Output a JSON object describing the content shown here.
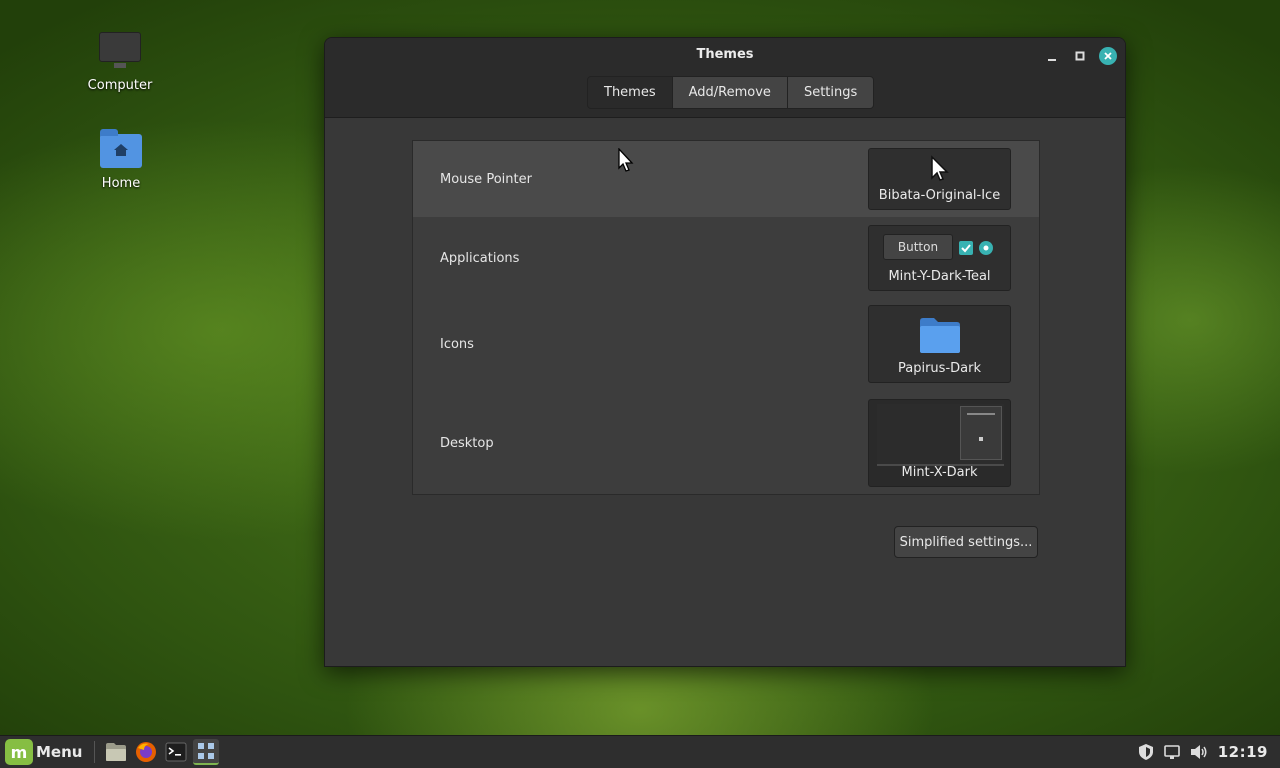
{
  "desktop": {
    "icons": [
      {
        "label": "Computer",
        "icon": "computer-icon"
      },
      {
        "label": "Home",
        "icon": "home-folder-icon"
      }
    ]
  },
  "window": {
    "title": "Themes",
    "controls": {
      "minimize": "minimize-icon",
      "maximize": "maximize-icon",
      "close": "close-icon"
    },
    "tabs": [
      {
        "label": "Themes",
        "active": true
      },
      {
        "label": "Add/Remove",
        "active": false
      },
      {
        "label": "Settings",
        "active": false
      }
    ],
    "rows": [
      {
        "label": "Mouse Pointer",
        "value": "Bibata-Original-Ice"
      },
      {
        "label": "Applications",
        "value": "Mint-Y-Dark-Teal",
        "sample_button": "Button"
      },
      {
        "label": "Icons",
        "value": "Papirus-Dark"
      },
      {
        "label": "Desktop",
        "value": "Mint-X-Dark"
      }
    ],
    "simplified_button": "Simplified settings..."
  },
  "taskbar": {
    "menu_label": "Menu",
    "launchers": [
      "files-icon",
      "firefox-icon",
      "terminal-icon",
      "themes-app-icon"
    ],
    "tray": [
      "shield-icon",
      "network-icon",
      "volume-icon"
    ],
    "clock": "12:19"
  },
  "colors": {
    "accent": "#38b2b2",
    "mint_green": "#86be43",
    "folder_blue": "#5294e2"
  }
}
